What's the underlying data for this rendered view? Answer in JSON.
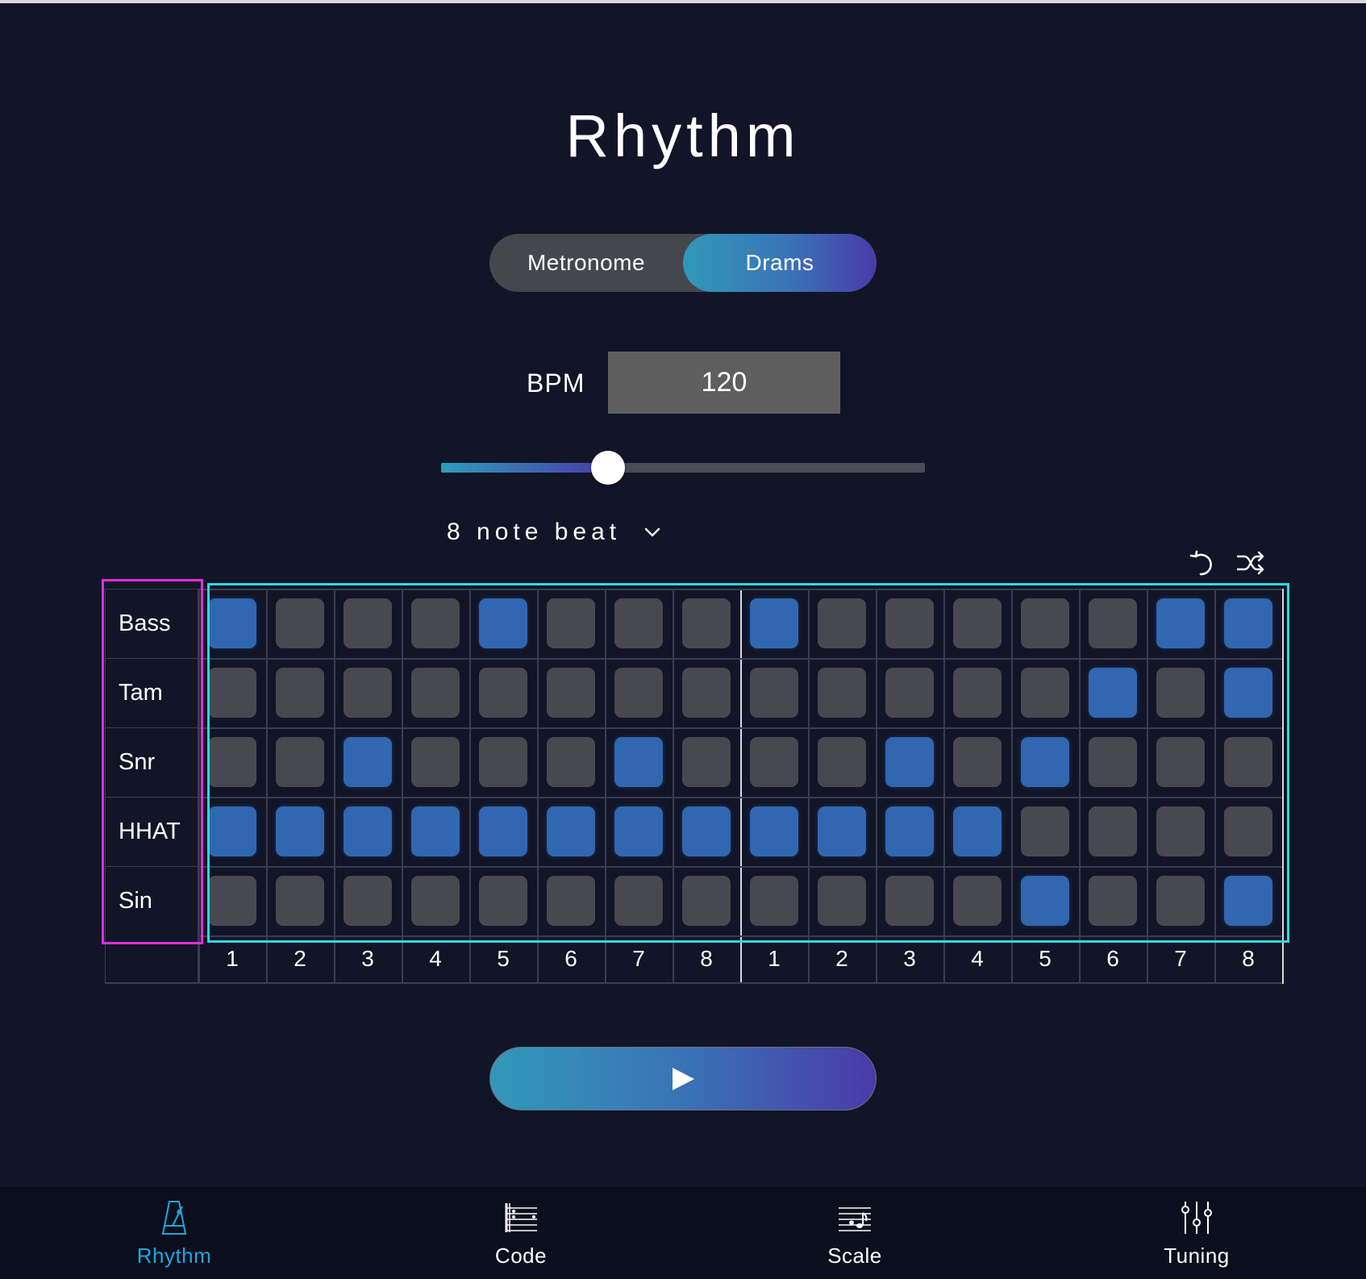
{
  "page": {
    "title": "Rhythm"
  },
  "mode_toggle": {
    "options": [
      "Metronome",
      "Drams"
    ],
    "selected": "Drams"
  },
  "bpm": {
    "label": "BPM",
    "value": "120"
  },
  "tempo_slider": {
    "fraction": 0.345
  },
  "beat_select": {
    "value": "8 note beat",
    "icon": "chevron-down-icon"
  },
  "toolbar": {
    "icons": [
      "undo-icon",
      "shuffle-icon"
    ]
  },
  "sequencer": {
    "rows": [
      {
        "label": "Bass",
        "steps": [
          1,
          0,
          0,
          0,
          1,
          0,
          0,
          0,
          1,
          0,
          0,
          0,
          0,
          0,
          1,
          1
        ]
      },
      {
        "label": "Tam",
        "steps": [
          0,
          0,
          0,
          0,
          0,
          0,
          0,
          0,
          0,
          0,
          0,
          0,
          0,
          1,
          0,
          1
        ]
      },
      {
        "label": "Snr",
        "steps": [
          0,
          0,
          1,
          0,
          0,
          0,
          1,
          0,
          0,
          0,
          1,
          0,
          1,
          0,
          0,
          0
        ]
      },
      {
        "label": "HHAT",
        "steps": [
          1,
          1,
          1,
          1,
          1,
          1,
          1,
          1,
          1,
          1,
          1,
          1,
          0,
          0,
          0,
          0
        ]
      },
      {
        "label": "Sin",
        "steps": [
          0,
          0,
          0,
          0,
          0,
          0,
          0,
          0,
          0,
          0,
          0,
          0,
          1,
          0,
          0,
          1
        ]
      }
    ],
    "step_numbers": [
      "1",
      "2",
      "3",
      "4",
      "5",
      "6",
      "7",
      "8",
      "1",
      "2",
      "3",
      "4",
      "5",
      "6",
      "7",
      "8"
    ]
  },
  "play_button": {
    "icon": "play-icon"
  },
  "bottom_nav": {
    "items": [
      {
        "label": "Rhythm",
        "icon": "metronome-icon",
        "active": true
      },
      {
        "label": "Code",
        "icon": "chord-sheet-icon",
        "active": false
      },
      {
        "label": "Scale",
        "icon": "music-staff-icon",
        "active": false
      },
      {
        "label": "Tuning",
        "icon": "sliders-icon",
        "active": false
      }
    ]
  },
  "colors": {
    "background": "#111527",
    "accent_active": "#1ea6e0",
    "cell_on": "#3166b0",
    "cell_off": "#484950",
    "highlight_magenta": "#e02ed9",
    "highlight_cyan": "#2bd9dd"
  }
}
